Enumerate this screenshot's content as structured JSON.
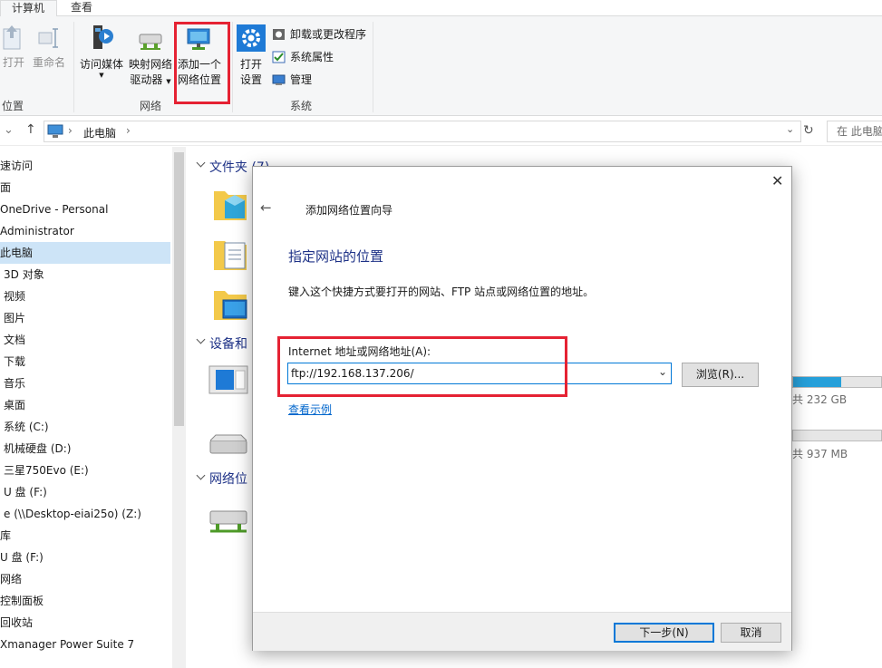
{
  "tabs": [
    "计算机",
    "查看"
  ],
  "ribbon": {
    "location_group": {
      "open": "打开",
      "rename": "重命名",
      "label": "位置"
    },
    "network_group": {
      "media": "访问媒体",
      "map_drive_1": "映射网络",
      "map_drive_2": "驱动器",
      "add_location_1": "添加一个",
      "add_location_2": "网络位置",
      "label": "网络"
    },
    "system_group": {
      "open_settings_1": "打开",
      "open_settings_2": "设置",
      "uninstall": "卸载或更改程序",
      "properties": "系统属性",
      "manage": "管理",
      "label": "系统"
    }
  },
  "address": {
    "path": "此电脑",
    "search_placeholder": "在 此电脑"
  },
  "nav": [
    {
      "label": "速访问",
      "indent": 0
    },
    {
      "label": "面",
      "indent": 0
    },
    {
      "label": "OneDrive - Personal",
      "indent": 0
    },
    {
      "label": "Administrator",
      "indent": 0
    },
    {
      "label": "此电脑",
      "indent": 0,
      "selected": true
    },
    {
      "label": "3D 对象",
      "indent": 1
    },
    {
      "label": "视频",
      "indent": 1
    },
    {
      "label": "图片",
      "indent": 1
    },
    {
      "label": "文档",
      "indent": 1
    },
    {
      "label": "下载",
      "indent": 1
    },
    {
      "label": "音乐",
      "indent": 1
    },
    {
      "label": "桌面",
      "indent": 1
    },
    {
      "label": "系统 (C:)",
      "indent": 1
    },
    {
      "label": "机械硬盘 (D:)",
      "indent": 1
    },
    {
      "label": "三星750Evo (E:)",
      "indent": 1
    },
    {
      "label": "U 盘 (F:)",
      "indent": 1
    },
    {
      "label": "e (\\\\Desktop-eiai25o) (Z:)",
      "indent": 1
    },
    {
      "label": "库",
      "indent": 0
    },
    {
      "label": "U 盘 (F:)",
      "indent": 0
    },
    {
      "label": "网络",
      "indent": 0
    },
    {
      "label": "控制面板",
      "indent": 0
    },
    {
      "label": "回收站",
      "indent": 0
    },
    {
      "label": "Xmanager Power Suite 7",
      "indent": 0
    }
  ],
  "content": {
    "folders_head": "文件夹 (7)",
    "devices_head": "设备和",
    "network_head": "网络位",
    "drive1_total": "共 232 GB",
    "drive2_total": "共 937 MB",
    "drive1_fill": 0.55
  },
  "dialog": {
    "title": "添加网络位置向导",
    "heading": "指定网站的位置",
    "description": "键入这个快捷方式要打开的网站、FTP 站点或网络位置的地址。",
    "field_label": "Internet 地址或网络地址(A):",
    "field_value": "ftp://192.168.137.206/",
    "browse": "浏览(R)...",
    "examples_link": "查看示例",
    "next": "下一步(N)",
    "cancel": "取消"
  },
  "colors": {
    "accent": "#0078d7",
    "highlight": "#e52233",
    "heading": "#1e3287",
    "link": "#0066cc"
  }
}
